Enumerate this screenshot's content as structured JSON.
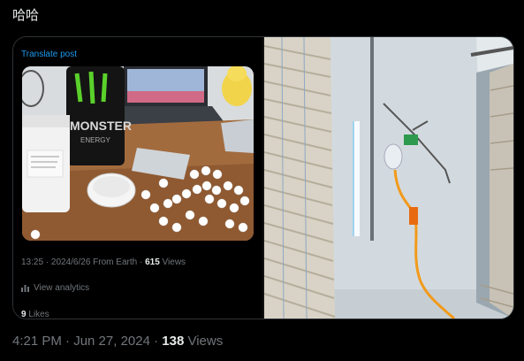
{
  "post": {
    "text": "哈哈"
  },
  "embedded_post": {
    "translate_label": "Translate post",
    "meta_prefix": "13:25 · 2024/6/26 From Earth · ",
    "views_count": "615",
    "views_label": " Views",
    "analytics_label": "View analytics",
    "likes_count": "9",
    "likes_label": " Likes",
    "can_brand": "MONSTER",
    "can_sub": "ENERGY"
  },
  "footer": {
    "time": "4:21 PM · Jun 27, 2024 · ",
    "views_count": "138",
    "views_label": " Views"
  }
}
